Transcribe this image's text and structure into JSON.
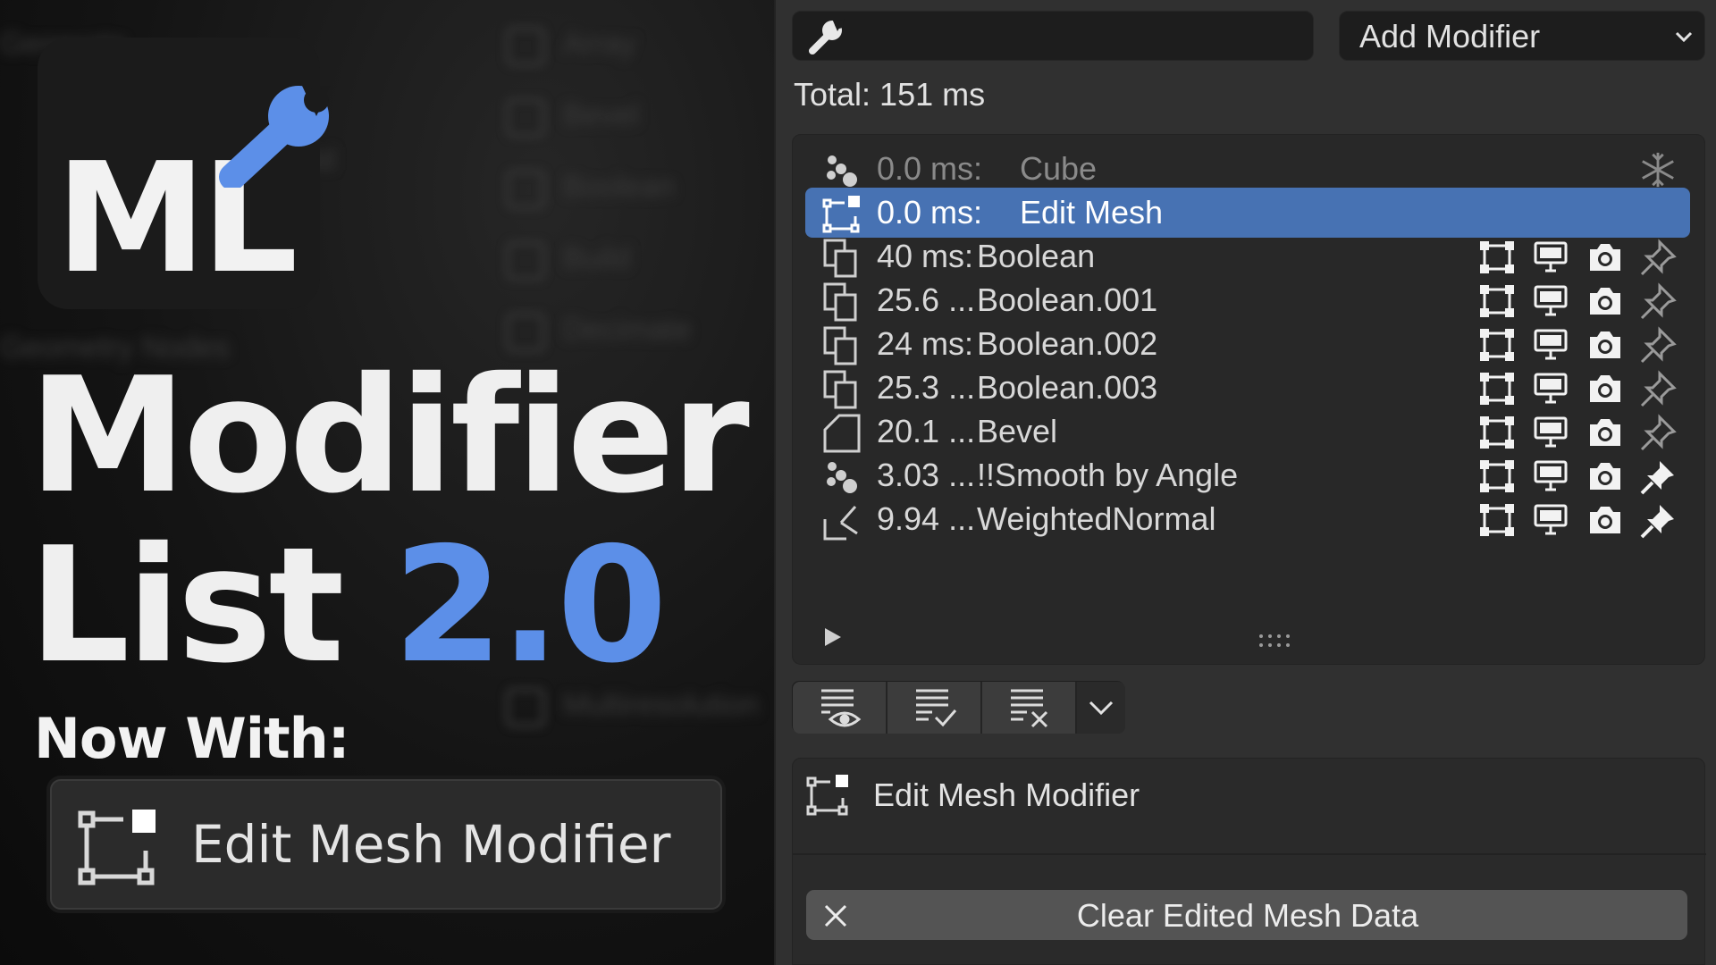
{
  "promo": {
    "logo_text": "ML",
    "title_line1": "Modifier",
    "title_line2": "List",
    "version": "2.0",
    "now_with": "Now With:",
    "feature_label": "Edit Mesh Modifier",
    "accent_color": "#5c8fe8"
  },
  "panel": {
    "search_placeholder": "",
    "search_icon": "wrench-icon",
    "add_modifier_label": "Add Modifier",
    "total_label": "Total: 151 ms",
    "modifiers": [
      {
        "time": "0.0 ms:",
        "name": "Cube",
        "icon": "object-dots-icon",
        "state": "dim",
        "pinned": false,
        "toggles": false
      },
      {
        "time": "0.0 ms:",
        "name": "Edit Mesh",
        "icon": "edit-mesh-icon",
        "state": "active",
        "pinned": false,
        "toggles": false
      },
      {
        "time": "40 ms:",
        "name": "Boolean",
        "icon": "boolean-icon",
        "state": "normal",
        "pinned": false,
        "toggles": true
      },
      {
        "time": "25.6 ...",
        "name": "Boolean.001",
        "icon": "boolean-icon",
        "state": "normal",
        "pinned": false,
        "toggles": true
      },
      {
        "time": "24 ms:",
        "name": "Boolean.002",
        "icon": "boolean-icon",
        "state": "normal",
        "pinned": false,
        "toggles": true
      },
      {
        "time": "25.3 ...",
        "name": "Boolean.003",
        "icon": "boolean-icon",
        "state": "normal",
        "pinned": false,
        "toggles": true
      },
      {
        "time": "20.1 ...",
        "name": "Bevel",
        "icon": "bevel-icon",
        "state": "normal",
        "pinned": false,
        "toggles": true
      },
      {
        "time": "3.03 ...",
        "name": "!!Smooth by Angle",
        "icon": "object-dots-icon",
        "state": "normal",
        "pinned": true,
        "toggles": true
      },
      {
        "time": "9.94 ...",
        "name": "WeightedNormal",
        "icon": "weighted-normal-icon",
        "state": "normal",
        "pinned": true,
        "toggles": true
      }
    ],
    "filter_buttons": [
      "filter-visible-icon",
      "filter-enabled-icon",
      "filter-disabled-icon"
    ],
    "properties_title": "Edit Mesh Modifier",
    "clear_button_label": "Clear Edited Mesh Data",
    "active_row_color": "#4772b3"
  }
}
